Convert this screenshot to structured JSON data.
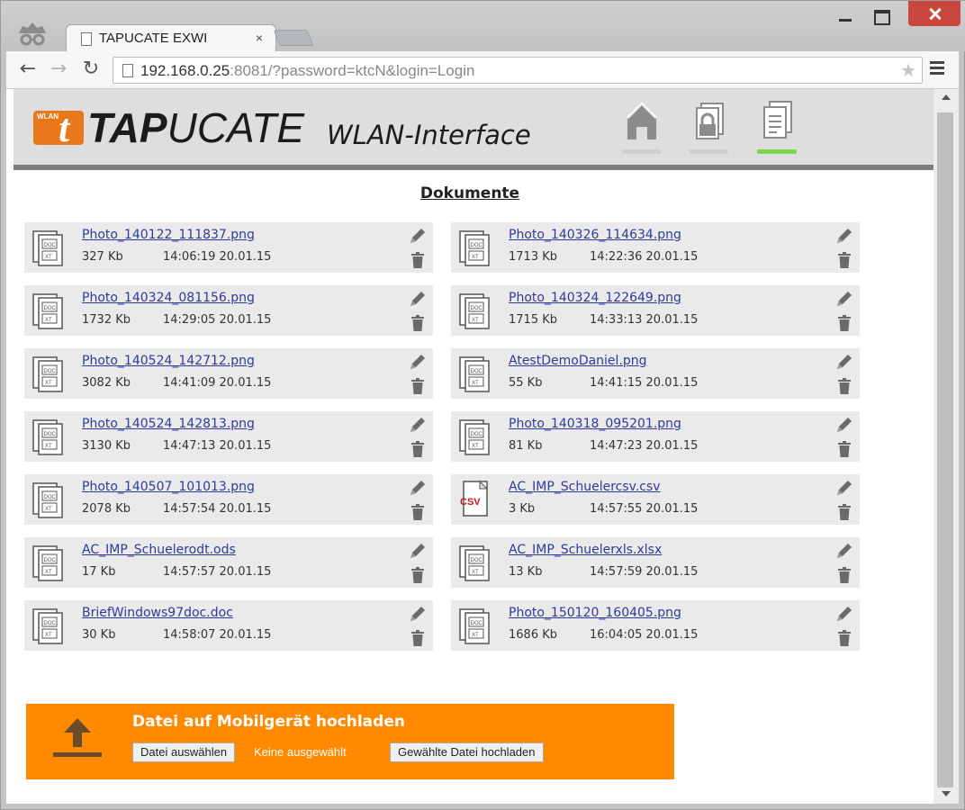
{
  "browser": {
    "tab_title": "TAPUCATE EXWI",
    "tab_close": "×",
    "url_host": "192.168.0.25",
    "url_rest": ":8081/?password=ktcN&login=Login",
    "nav": {
      "back": "←",
      "forward": "→",
      "reload": "↻",
      "star": "★"
    }
  },
  "header": {
    "logo_badge": "WLAN",
    "logo_letter": "t",
    "brand_bold": "TAP",
    "brand_rest": "UCATE",
    "subtitle": "WLAN-Interface",
    "nav": [
      {
        "name": "home",
        "active": false
      },
      {
        "name": "lock",
        "active": false
      },
      {
        "name": "documents",
        "active": true
      }
    ]
  },
  "page_title": "Dokumente",
  "documents": [
    {
      "name": "Photo_140122_111837.png",
      "size": "327 Kb",
      "time": "14:06:19 20.01.15",
      "type": "doc"
    },
    {
      "name": "Photo_140326_114634.png",
      "size": "1713 Kb",
      "time": "14:22:36 20.01.15",
      "type": "doc"
    },
    {
      "name": "Photo_140324_081156.png",
      "size": "1732 Kb",
      "time": "14:29:05 20.01.15",
      "type": "doc"
    },
    {
      "name": "Photo_140324_122649.png",
      "size": "1715 Kb",
      "time": "14:33:13 20.01.15",
      "type": "doc"
    },
    {
      "name": "Photo_140524_142712.png",
      "size": "3082 Kb",
      "time": "14:41:09 20.01.15",
      "type": "doc"
    },
    {
      "name": "AtestDemoDaniel.png",
      "size": "55 Kb",
      "time": "14:41:15 20.01.15",
      "type": "doc"
    },
    {
      "name": "Photo_140524_142813.png",
      "size": "3130 Kb",
      "time": "14:47:13 20.01.15",
      "type": "doc"
    },
    {
      "name": "Photo_140318_095201.png",
      "size": "81 Kb",
      "time": "14:47:23 20.01.15",
      "type": "doc"
    },
    {
      "name": "Photo_140507_101013.png",
      "size": "2078 Kb",
      "time": "14:57:54 20.01.15",
      "type": "doc"
    },
    {
      "name": "AC_IMP_Schuelercsv.csv",
      "size": "3 Kb",
      "time": "14:57:55 20.01.15",
      "type": "csv"
    },
    {
      "name": "AC_IMP_Schuelerodt.ods",
      "size": "17 Kb",
      "time": "14:57:57 20.01.15",
      "type": "doc"
    },
    {
      "name": "AC_IMP_Schuelerxls.xlsx",
      "size": "13 Kb",
      "time": "14:57:59 20.01.15",
      "type": "doc"
    },
    {
      "name": "BriefWindows97doc.doc",
      "size": "30 Kb",
      "time": "14:58:07 20.01.15",
      "type": "doc"
    },
    {
      "name": "Photo_150120_160405.png",
      "size": "1686 Kb",
      "time": "16:04:05 20.01.15",
      "type": "doc"
    }
  ],
  "file_icon_labels": {
    "doc_top": "DOC",
    "doc_bottom": "XT",
    "csv": "CSV"
  },
  "upload": {
    "title": "Datei auf Mobilgerät hochladen",
    "choose_label": "Datei auswählen",
    "no_file_text": "Keine ausgewählt",
    "upload_label": "Gewählte Datei hochladen"
  },
  "colors": {
    "accent_orange": "#ff8a00",
    "logo_orange": "#e9781a",
    "active_nav": "#7cd64b",
    "link": "#2f3b9b"
  }
}
